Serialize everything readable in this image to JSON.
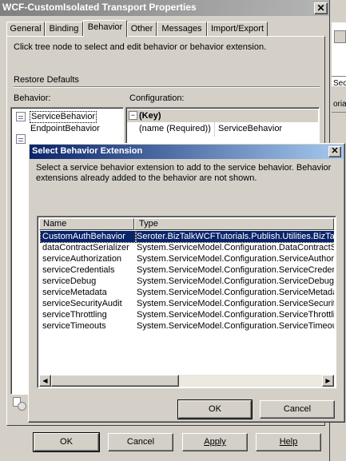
{
  "outer": {
    "title": "WCF-CustomIsolated Transport Properties",
    "tabs": [
      "General",
      "Binding",
      "Behavior",
      "Other",
      "Messages",
      "Import/Export"
    ],
    "active_tab": "Behavior",
    "hint": "Click tree node to select and edit behavior or behavior extension.",
    "restore_defaults": "Restore Defaults",
    "behavior_label": "Behavior:",
    "configuration_label": "Configuration:",
    "tree": [
      "ServiceBehavior",
      "EndpointBehavior"
    ],
    "config": {
      "section": "(Key)",
      "prop_name": "(name (Required))",
      "prop_value": "ServiceBehavior"
    },
    "buttons": {
      "ok": "OK",
      "cancel": "Cancel",
      "apply": "Apply",
      "help": "Help"
    }
  },
  "background_right": {
    "frag1": "Secu",
    "frag2": "orials"
  },
  "dialog": {
    "title": "Select Behavior Extension",
    "message": "Select a service behavior extension to add to the service behavior. Behavior extensions already added to the behavior are not shown.",
    "columns": {
      "name": "Name",
      "type": "Type"
    },
    "rows": [
      {
        "name": "CustomAuthBehavior",
        "type": "Seroter.BizTalkWCFTutorials.Publish.Utilities.BizTalk"
      },
      {
        "name": "dataContractSerializer",
        "type": "System.ServiceModel.Configuration.DataContractSe"
      },
      {
        "name": "serviceAuthorization",
        "type": "System.ServiceModel.Configuration.ServiceAuthoriz"
      },
      {
        "name": "serviceCredentials",
        "type": "System.ServiceModel.Configuration.ServiceCredenti"
      },
      {
        "name": "serviceDebug",
        "type": "System.ServiceModel.Configuration.ServiceDebugEl"
      },
      {
        "name": "serviceMetadata",
        "type": "System.ServiceModel.Configuration.ServiceMetadat"
      },
      {
        "name": "serviceSecurityAudit",
        "type": "System.ServiceModel.Configuration.ServiceSecurityA"
      },
      {
        "name": "serviceThrottling",
        "type": "System.ServiceModel.Configuration.ServiceThrottlin"
      },
      {
        "name": "serviceTimeouts",
        "type": "System.ServiceModel.Configuration.ServiceTimeouts"
      }
    ],
    "selected_index": 0,
    "buttons": {
      "ok": "OK",
      "cancel": "Cancel"
    }
  }
}
